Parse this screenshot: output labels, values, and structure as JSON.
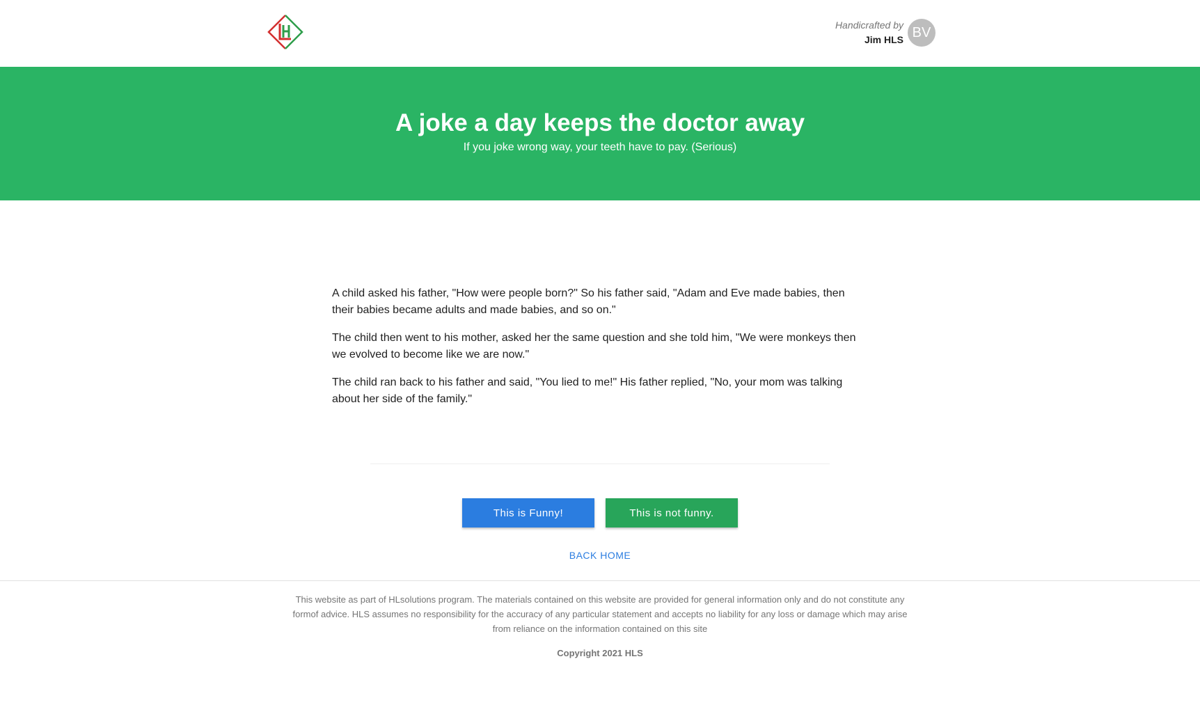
{
  "header": {
    "logo_letters": "HL",
    "handcrafted_label": "Handicrafted by",
    "author_name": "Jim HLS",
    "avatar_initials": "BV"
  },
  "hero": {
    "title": "A joke a day keeps the doctor away",
    "subtitle": "If you joke wrong way, your teeth have to pay. (Serious)"
  },
  "story": {
    "paragraphs": [
      "A child asked his father, \"How were people born?\" So his father said, \"Adam and Eve made babies, then their babies became adults and made babies, and so on.\"",
      "The child then went to his mother, asked her the same question and she told him, \"We were monkeys then we evolved to become like we are now.\"",
      "The child ran back to his father and said, \"You lied to me!\" His father replied, \"No, your mom was talking about her side of the family.\""
    ]
  },
  "actions": {
    "funny_label": "This is Funny!",
    "not_funny_label": "This is not funny.",
    "back_home_label": "BACK HOME"
  },
  "footer": {
    "disclaimer": "This website as part of HLsolutions program. The materials contained on this website are provided for general information only and do not constitute any formof advice. HLS assumes no responsibility for the accuracy of any particular statement and accepts no liability for any loss or damage which may arise from reliance on the information contained on this site",
    "copyright": "Copyright 2021 HLS"
  },
  "colors": {
    "hero_background": "#2ab464",
    "funny_button": "#2b7de0",
    "not_funny_button": "#28a55a",
    "link": "#2b7de0",
    "logo_red": "#d32f2f",
    "logo_green": "#2e9e4a"
  }
}
